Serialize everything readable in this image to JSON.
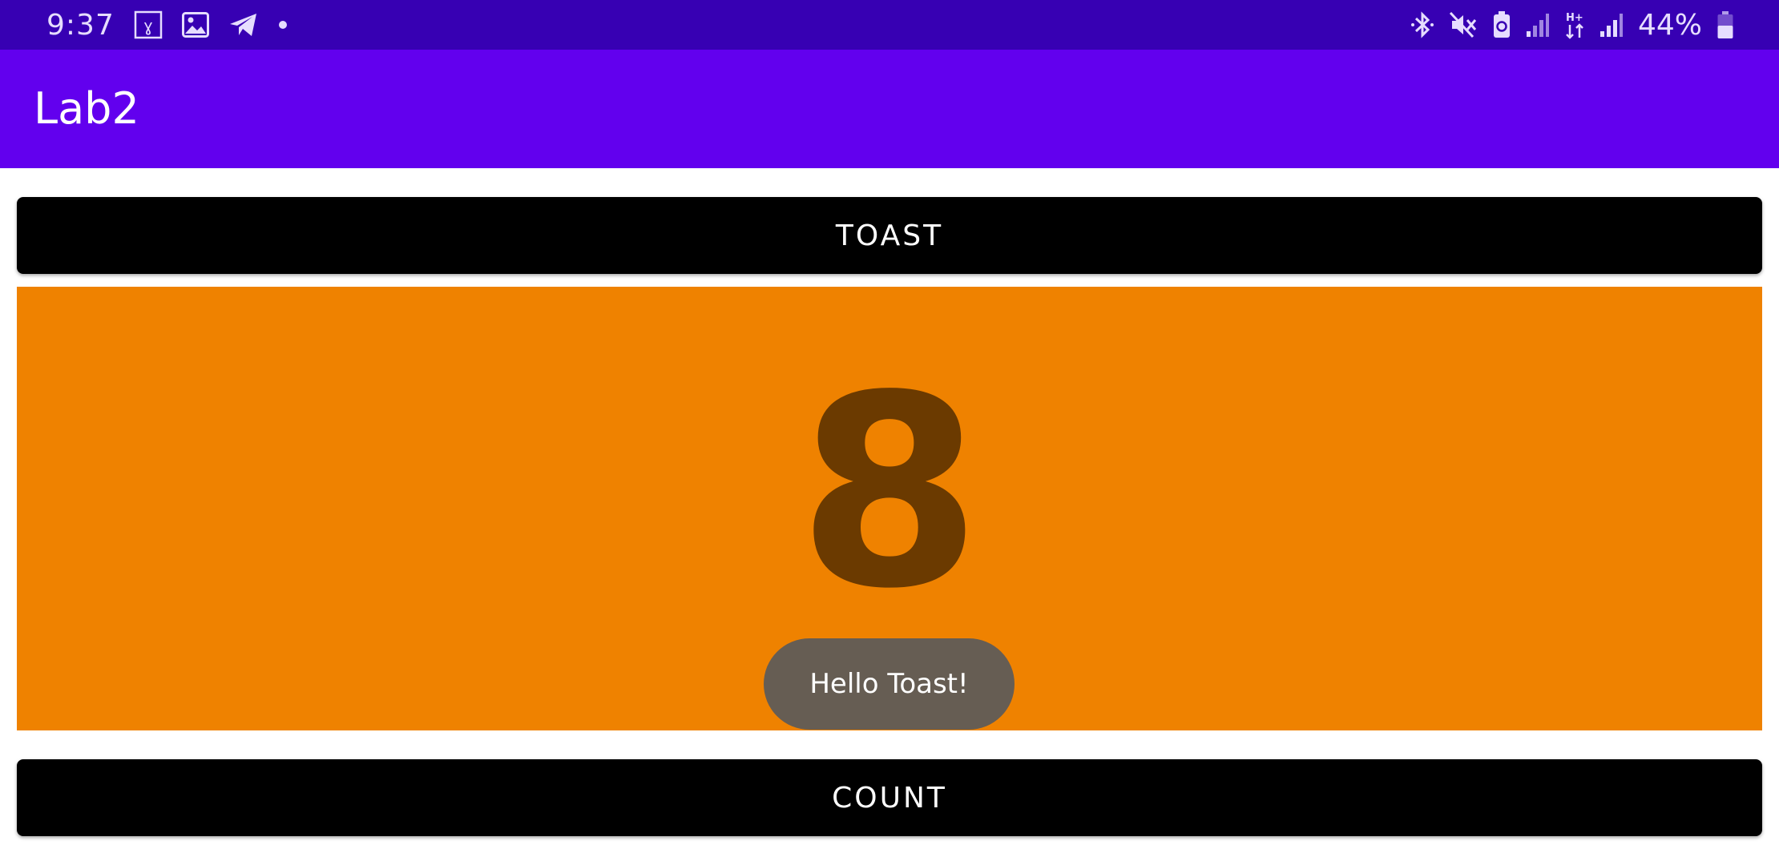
{
  "status_bar": {
    "time": "9:37",
    "battery_percent": "44%",
    "left_icons": [
      "app-notification-icon",
      "gallery-icon",
      "telegram-icon",
      "more-notifications-dot-icon"
    ],
    "right_icons": [
      "bluetooth-icon",
      "mute-icon",
      "battery-saver-icon",
      "signal-icon",
      "hplus-data-icon",
      "signal-icon",
      "battery-icon"
    ],
    "background": "#3700b3"
  },
  "app_bar": {
    "title": "Lab2",
    "background": "#6200ee"
  },
  "toast_button": {
    "label": "TOAST"
  },
  "counter": {
    "value": "8",
    "background": "#ef8200",
    "text_color": "#6b3a00"
  },
  "count_button": {
    "label": "COUNT"
  },
  "toast_message": {
    "text": "Hello Toast!"
  }
}
